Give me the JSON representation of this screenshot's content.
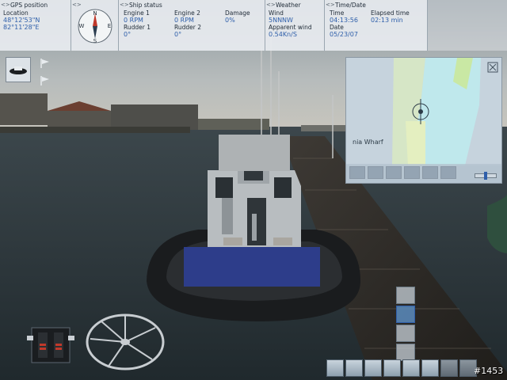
{
  "hud": {
    "gps": {
      "title": "GPS position",
      "location_label": "Location",
      "lat": "48°12'53\"N",
      "lon": "82°11'28\"E"
    },
    "compass": {
      "n": "N",
      "s": "S",
      "e": "E",
      "w": "W"
    },
    "ship": {
      "title": "Ship status",
      "engine1_label": "Engine 1",
      "engine1_value": "0 RPM",
      "engine2_label": "Engine 2",
      "engine2_value": "0 RPM",
      "damage_label": "Damage",
      "damage_value": "0%",
      "rudder1_label": "Rudder 1",
      "rudder1_value": "0°",
      "rudder2_label": "Rudder 2",
      "rudder2_value": "0°"
    },
    "weather": {
      "title": "Weather",
      "wind_label": "Wind",
      "wind_value": "5NNNW",
      "apparent_label": "Apparent wind",
      "apparent_value": "0.54Kn/S"
    },
    "time": {
      "title": "Time/Date",
      "time_label": "Time",
      "time_value": "04:13:56",
      "elapsed_label": "Elapsed time",
      "elapsed_value": "02:13 min",
      "date_label": "Date",
      "date_value": "05/23/07"
    }
  },
  "minimap": {
    "label": "nia Wharf",
    "zoom_fraction": 0.45
  },
  "frame_number": "#1453",
  "icons": {
    "left": [
      "boat-icon",
      "flag-icon",
      "flag-icon"
    ],
    "view_column": [
      "camera-rear-icon",
      "camera-bridge-icon",
      "camera-free-icon",
      "camera-tower-icon"
    ],
    "bottom_bar": [
      "info-icon",
      "map-icon",
      "knot-icon",
      "rope-icon",
      "camera-icon",
      "ship-view-icon",
      "lens-icon",
      "grid-icon",
      "window-icon",
      "settings-icon"
    ]
  },
  "colors": {
    "hud_value": "#2f5faa",
    "water": "#2a3438",
    "sky": "#a9b2b6"
  }
}
